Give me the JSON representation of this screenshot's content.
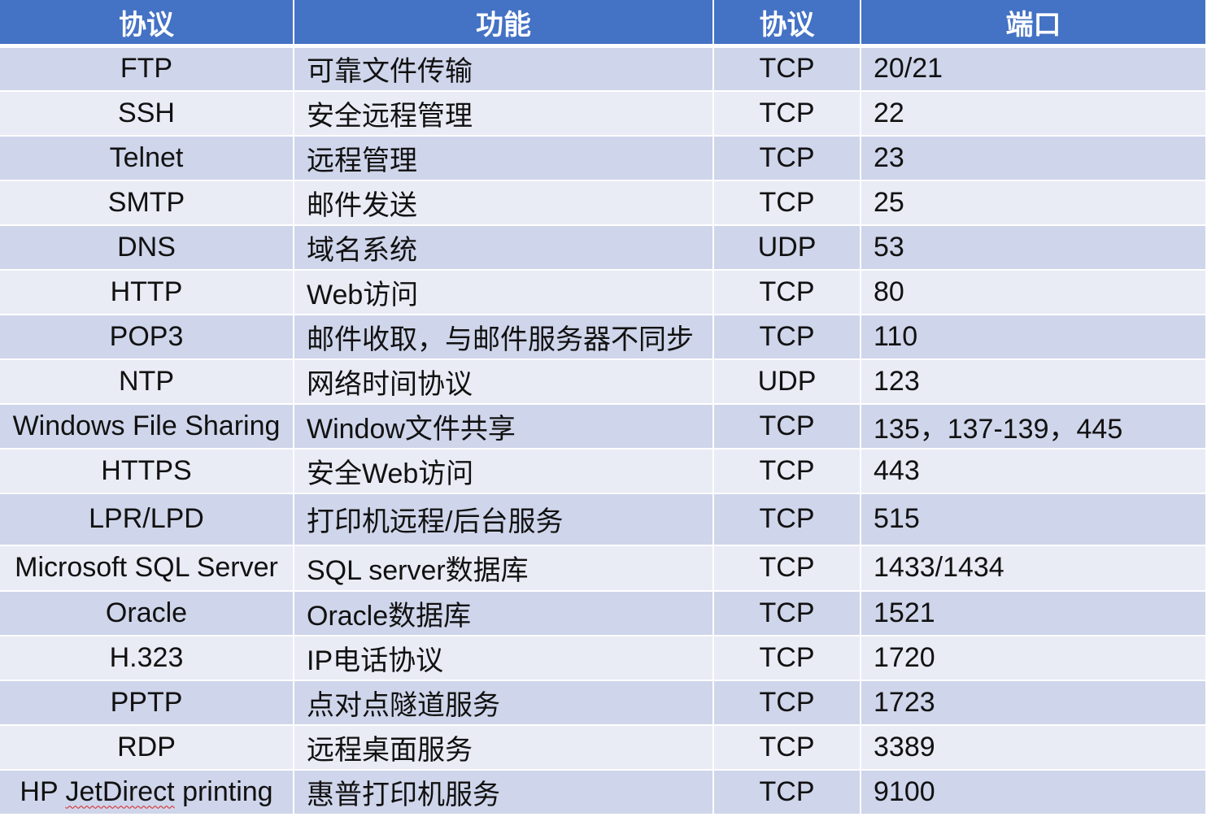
{
  "headers": [
    "协议",
    "功能",
    "协议",
    "端口"
  ],
  "rows": [
    {
      "protocol": "FTP",
      "function": "可靠文件传输",
      "transport": "TCP",
      "port": "20/21"
    },
    {
      "protocol": "SSH",
      "function": "安全远程管理",
      "transport": "TCP",
      "port": "22"
    },
    {
      "protocol": "Telnet",
      "function": "远程管理",
      "transport": "TCP",
      "port": "23"
    },
    {
      "protocol": "SMTP",
      "function": "邮件发送",
      "transport": "TCP",
      "port": "25"
    },
    {
      "protocol": "DNS",
      "function": "域名系统",
      "transport": "UDP",
      "port": "53"
    },
    {
      "protocol": "HTTP",
      "function": "Web访问",
      "transport": "TCP",
      "port": "80"
    },
    {
      "protocol": "POP3",
      "function": "邮件收取，与邮件服务器不同步",
      "transport": "TCP",
      "port": "110"
    },
    {
      "protocol": "NTP",
      "function": "网络时间协议",
      "transport": "UDP",
      "port": "123"
    },
    {
      "protocol": "Windows File Sharing",
      "function": "Window文件共享",
      "transport": "TCP",
      "port": "135，137-139，445"
    },
    {
      "protocol": "HTTPS",
      "function": "安全Web访问",
      "transport": "TCP",
      "port": "443"
    },
    {
      "protocol": "LPR/LPD",
      "function": "打印机远程/后台服务",
      "transport": "TCP",
      "port": "515"
    },
    {
      "protocol": "Microsoft SQL Server",
      "function": "SQL server数据库",
      "transport": "TCP",
      "port": "1433/1434"
    },
    {
      "protocol": "Oracle",
      "function": "Oracle数据库",
      "transport": "TCP",
      "port": "1521"
    },
    {
      "protocol": "H.323",
      "function": "IP电话协议",
      "transport": "TCP",
      "port": "1720"
    },
    {
      "protocol": "PPTP",
      "function": "点对点隧道服务",
      "transport": "TCP",
      "port": "1723"
    },
    {
      "protocol": "RDP",
      "function": "远程桌面服务",
      "transport": "TCP",
      "port": "3389"
    },
    {
      "protocol": "HP JetDirect printing",
      "function": "惠普打印机服务",
      "transport": "TCP",
      "port": "9100"
    }
  ],
  "colors": {
    "header_bg": "#4472c4",
    "header_text": "#ffffff",
    "row_odd": "#cfd5ea",
    "row_even": "#e9ebf5",
    "spellcheck_underline": "#d92020"
  }
}
